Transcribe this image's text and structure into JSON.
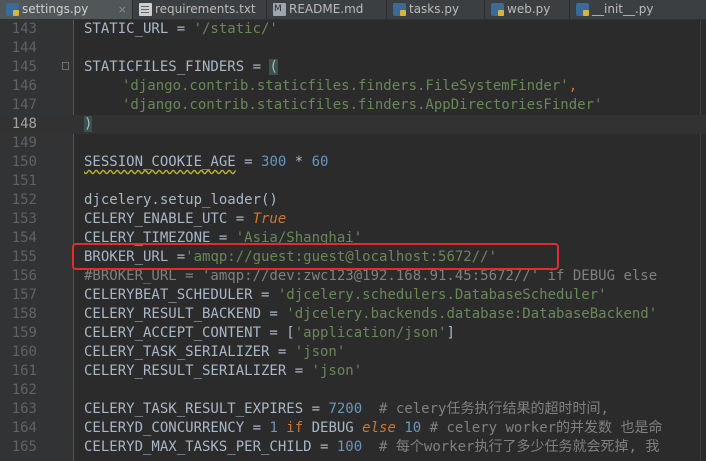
{
  "tabs": [
    {
      "label": "settings.py",
      "icon": "python-file-icon",
      "active": true
    },
    {
      "label": "requirements.txt",
      "icon": "text-file-icon",
      "active": false
    },
    {
      "label": "README.md",
      "icon": "markdown-file-icon",
      "active": false
    },
    {
      "label": "tasks.py",
      "icon": "python-file-icon",
      "active": false
    },
    {
      "label": "web.py",
      "icon": "python-file-icon",
      "active": false
    },
    {
      "label": "__init__.py",
      "icon": "python-file-icon",
      "active": false
    }
  ],
  "close_glyph": "×",
  "line_numbers": [
    "143",
    "144",
    "145",
    "146",
    "147",
    "148",
    "149",
    "150",
    "151",
    "152",
    "153",
    "154",
    "155",
    "156",
    "157",
    "158",
    "159",
    "160",
    "161",
    "162",
    "163",
    "164",
    "165"
  ],
  "current_line": "148",
  "highlighted_line": "155",
  "code": {
    "l143": {
      "a": "STATIC_URL = ",
      "b": "'/static/'"
    },
    "l145": {
      "a": "STATICFILES_FINDERS = ",
      "b": "("
    },
    "l146": {
      "a": "'django.contrib.staticfiles.finders.FileSystemFinder'",
      "b": ","
    },
    "l147": {
      "a": "'django.contrib.staticfiles.finders.AppDirectoriesFinder'"
    },
    "l148": {
      "a": ")"
    },
    "l150": {
      "a": "SESSION_COOKIE_AGE",
      "b": " = ",
      "c": "300",
      "d": " * ",
      "e": "60"
    },
    "l152": {
      "a": "djcelery.setup_loader()"
    },
    "l153": {
      "a": "CELERY_ENABLE_UTC = ",
      "b": "True"
    },
    "l154": {
      "a": "CELERY_TIMEZONE = ",
      "b": "'Asia/Shanghai'"
    },
    "l155": {
      "a": "BROKER_URL =",
      "b": "'amqp://guest:guest@localhost:5672//'"
    },
    "l156": {
      "a": "#BROKER_URL = 'amqp://dev:zwc123@192.168.91.45:5672//' if DEBUG else"
    },
    "l157": {
      "a": "CELERYBEAT_SCHEDULER = ",
      "b": "'djcelery.schedulers.DatabaseScheduler'"
    },
    "l158": {
      "a": "CELERY_RESULT_BACKEND = ",
      "b": "'djcelery.backends.database:DatabaseBackend'"
    },
    "l159": {
      "a": "CELERY_ACCEPT_CONTENT = [",
      "b": "'application/json'",
      "c": "]"
    },
    "l160": {
      "a": "CELERY_TASK_SERIALIZER = ",
      "b": "'json'"
    },
    "l161": {
      "a": "CELERY_RESULT_SERIALIZER = ",
      "b": "'json'"
    },
    "l163": {
      "a": "CELERY_TASK_RESULT_EXPIRES = ",
      "b": "7200",
      "c": "  # celery任务执行结果的超时时间,"
    },
    "l164": {
      "a": "CELERYD_CONCURRENCY = ",
      "b": "1",
      "c": " if ",
      "d": "DEBUG ",
      "e": "else",
      "f": " 10",
      "g": " # celery worker的并发数 也是命"
    },
    "l165": {
      "a": "CELERYD_MAX_TASKS_PER_CHILD = ",
      "b": "100",
      "c": "  # 每个worker执行了多少任务就会死掉, 我"
    }
  },
  "colors": {
    "background": "#2b2b2b",
    "gutter": "#313335",
    "string": "#6a8759",
    "number": "#6897bb",
    "keyword": "#cc7832",
    "comment": "#808080",
    "annotation_box": "#e02d2d"
  }
}
